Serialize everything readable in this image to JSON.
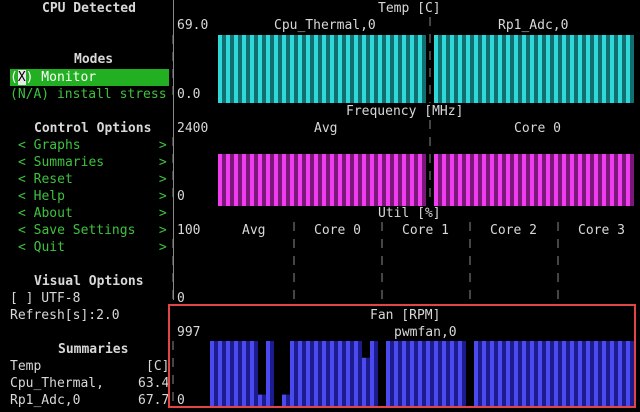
{
  "sidebar": {
    "cpu_detected": "CPU Detected",
    "modes_title": "Modes",
    "modes": [
      {
        "prefix": "(",
        "mark": "X",
        "suffix": ") Monitor"
      },
      {
        "label": "(N/A) install stress"
      }
    ],
    "control_title": "Control Options",
    "controls": [
      {
        "label": "< Graphs          >"
      },
      {
        "label": "< Summaries       >"
      },
      {
        "label": "< Reset           >"
      },
      {
        "label": "< Help            >"
      },
      {
        "label": "< About           >"
      },
      {
        "label": "< Save Settings   >"
      },
      {
        "label": "< Quit            >"
      }
    ],
    "visual_title": "Visual Options",
    "utf8": "[ ] UTF-8",
    "refresh": "Refresh[s]:2.0",
    "summaries_title": "Summaries",
    "summary_rows": [
      {
        "name": "Temp",
        "value": "[C]"
      },
      {
        "name": "Cpu_Thermal,",
        "value": "63.4"
      },
      {
        "name": "Rp1_Adc,0",
        "value": "67.7"
      }
    ]
  },
  "graphs": {
    "temp": {
      "title": "Temp [C]",
      "max": "69.0",
      "min": "0.0",
      "series": [
        "Cpu_Thermal,0",
        "Rp1_Adc,0"
      ],
      "color_a": "#2ed8d8",
      "color_b": "#126f6f"
    },
    "freq": {
      "title": "Frequency [MHz]",
      "max": "2400",
      "min": "0",
      "series": [
        "Avg",
        "Core 0"
      ],
      "color_a": "#ee3cee",
      "color_b": "#7a187a"
    },
    "util": {
      "title": "Util [%]",
      "max": "100",
      "min": "0",
      "series": [
        "Avg",
        "Core 0",
        "Core 1",
        "Core 2",
        "Core 3"
      ]
    },
    "fan": {
      "title": "Fan [RPM]",
      "max": "997",
      "min": "0",
      "series": [
        "pwmfan,0"
      ],
      "color_a": "#4a4aee",
      "color_b": "#1c1c8e"
    }
  }
}
